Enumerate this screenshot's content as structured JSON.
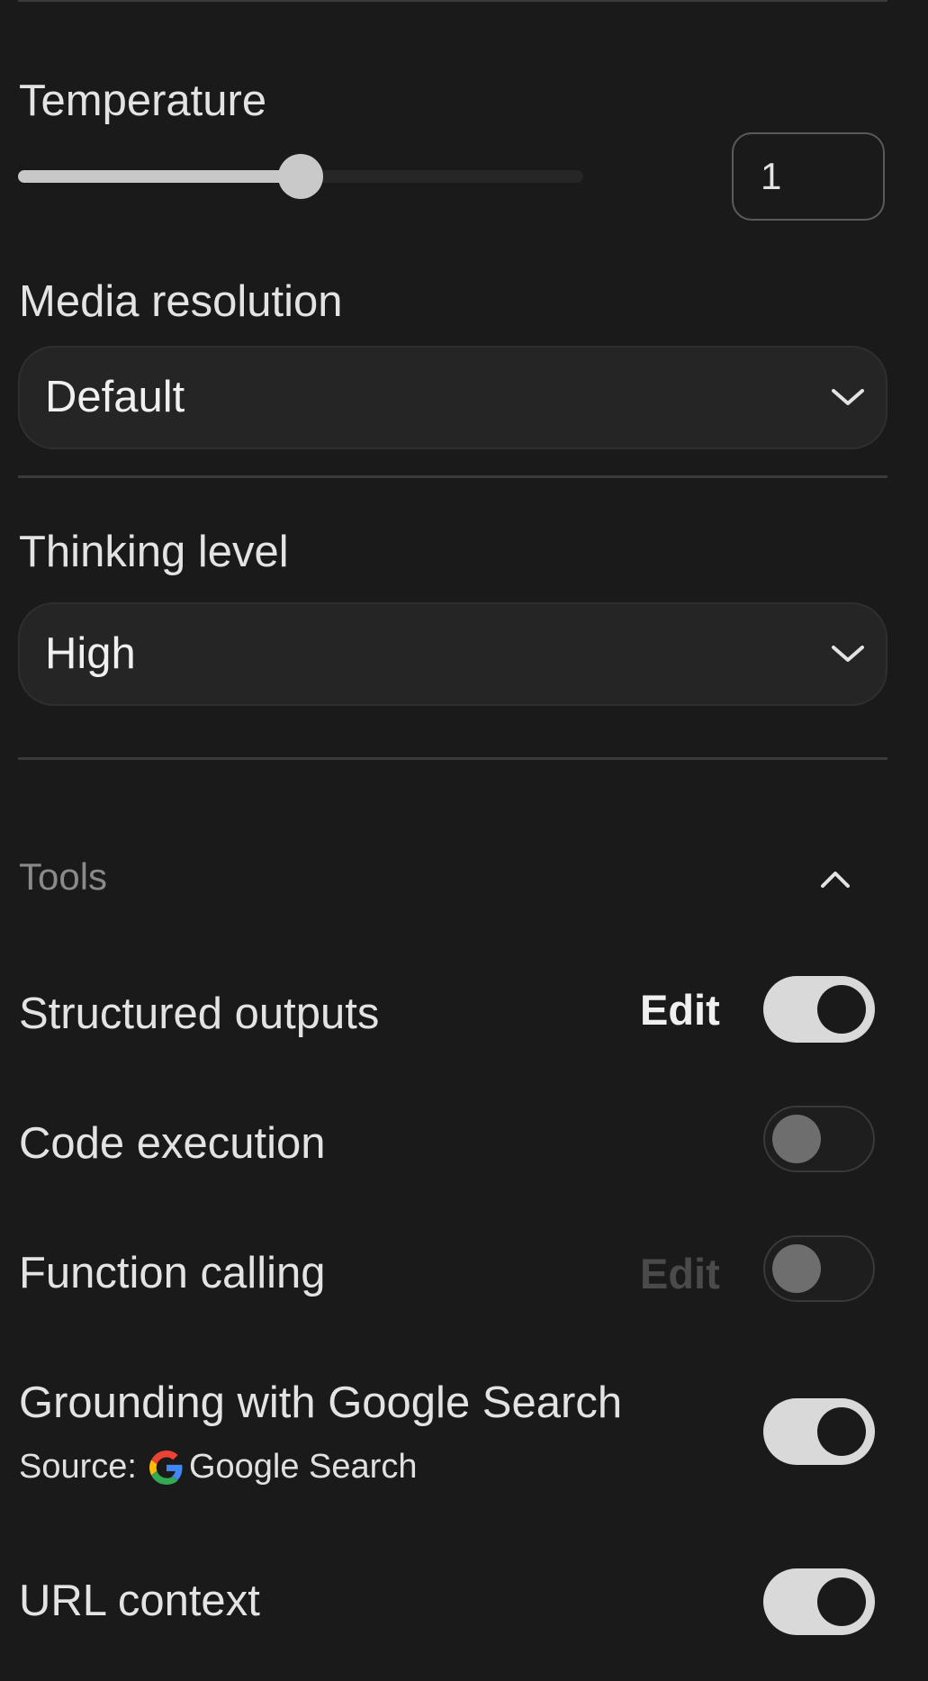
{
  "temperature": {
    "label": "Temperature",
    "value": "1",
    "slider_fraction": 0.5
  },
  "media_resolution": {
    "label": "Media resolution",
    "selected": "Default"
  },
  "thinking_level": {
    "label": "Thinking level",
    "selected": "High"
  },
  "tools": {
    "title": "Tools",
    "items": [
      {
        "label": "Structured outputs",
        "edit_label": "Edit",
        "edit_enabled": true,
        "enabled": true
      },
      {
        "label": "Code execution",
        "enabled": false
      },
      {
        "label": "Function calling",
        "edit_label": "Edit",
        "edit_enabled": false,
        "enabled": false
      },
      {
        "label": "Grounding with Google Search",
        "source_prefix": "Source:",
        "source_name": "Google Search",
        "enabled": true
      },
      {
        "label": "URL context",
        "enabled": true
      }
    ]
  },
  "icons": {
    "dropdown": "chevron-down-icon",
    "collapse": "chevron-up-icon",
    "source": "google-g-icon"
  }
}
